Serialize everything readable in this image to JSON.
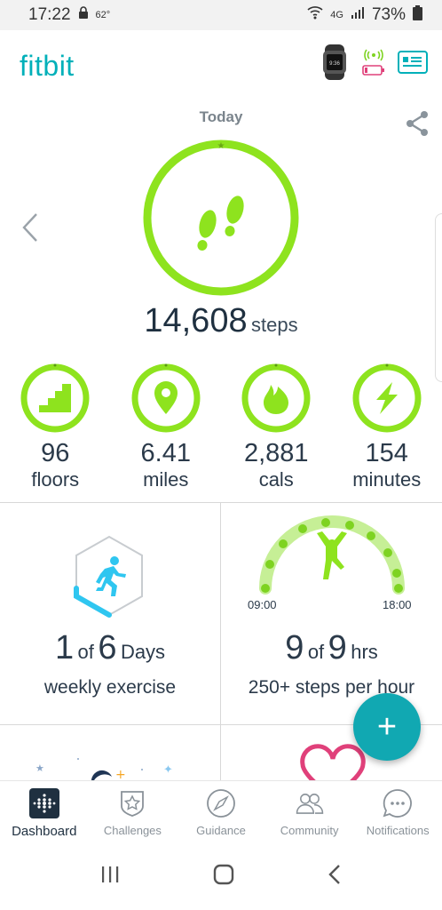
{
  "status_bar": {
    "time": "17:22",
    "temperature": "62°",
    "network": "4G",
    "battery": "73%"
  },
  "header": {
    "logo": "fitbit"
  },
  "dashboard": {
    "date_label": "Today",
    "steps": {
      "value": "14,608",
      "unit": "steps"
    },
    "metrics": [
      {
        "value": "96",
        "unit": "floors",
        "icon": "stairs-icon"
      },
      {
        "value": "6.41",
        "unit": "miles",
        "icon": "location-pin-icon"
      },
      {
        "value": "2,881",
        "unit": "cals",
        "icon": "flame-icon"
      },
      {
        "value": "154",
        "unit": "minutes",
        "icon": "lightning-icon"
      }
    ],
    "exercise": {
      "count": "1",
      "of": "of",
      "total": "6",
      "unit": "Days",
      "label": "weekly exercise"
    },
    "hourly": {
      "start_time": "09:00",
      "end_time": "18:00",
      "count": "9",
      "of": "of",
      "total": "9",
      "unit": "hrs",
      "label": "250+ steps per hour"
    }
  },
  "fab": {
    "label": "+"
  },
  "bottom_nav": [
    {
      "label": "Dashboard",
      "icon": "dashboard-dots-icon"
    },
    {
      "label": "Challenges",
      "icon": "star-shield-icon"
    },
    {
      "label": "Guidance",
      "icon": "compass-icon"
    },
    {
      "label": "Community",
      "icon": "people-icon"
    },
    {
      "label": "Notifications",
      "icon": "chat-bubble-icon"
    }
  ],
  "colors": {
    "brand": "#00b0b9",
    "ring": "#8ee31e",
    "text": "#2b3a4a"
  }
}
